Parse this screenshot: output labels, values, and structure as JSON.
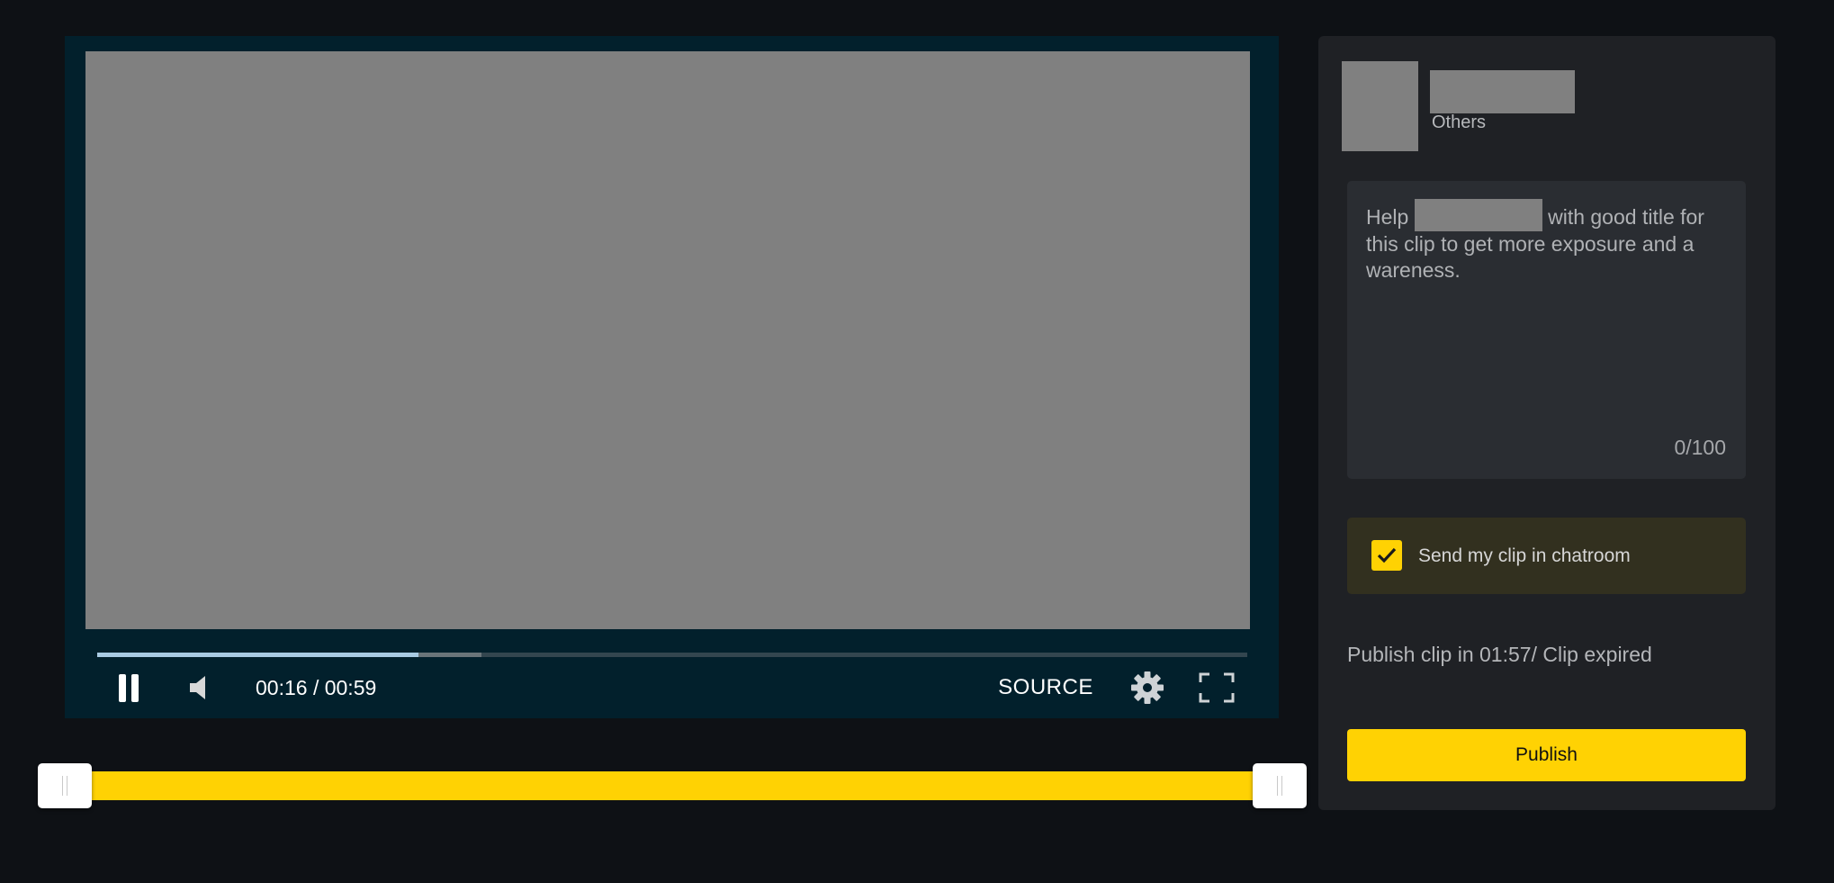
{
  "player": {
    "time_display": "00:16 / 00:59",
    "source_label": "SOURCE",
    "played_fraction": 0.279,
    "buffered_fraction": 0.334,
    "icons": {
      "play_state": "pause-icon",
      "volume": "volume-icon",
      "settings": "gear-icon",
      "fullscreen": "fullscreen-icon"
    }
  },
  "trim": {
    "start_fraction": 0.0,
    "end_fraction": 1.0,
    "color": "#ffd203"
  },
  "panel": {
    "category": "Others",
    "title_hint_before": "Help",
    "title_hint_after": "with good title for this clip to get more exposure and a wareness.",
    "title_counter": "0/100",
    "send_to_chatroom": {
      "checked": true,
      "label": "Send my clip in chatroom"
    },
    "publish_timer": "Publish clip in 01:57/ Clip expired",
    "publish_label": "Publish"
  },
  "colors": {
    "accent": "#ffd203",
    "background": "#0e1115",
    "player_bg": "#02202c",
    "panel_bg": "#1f2125"
  }
}
